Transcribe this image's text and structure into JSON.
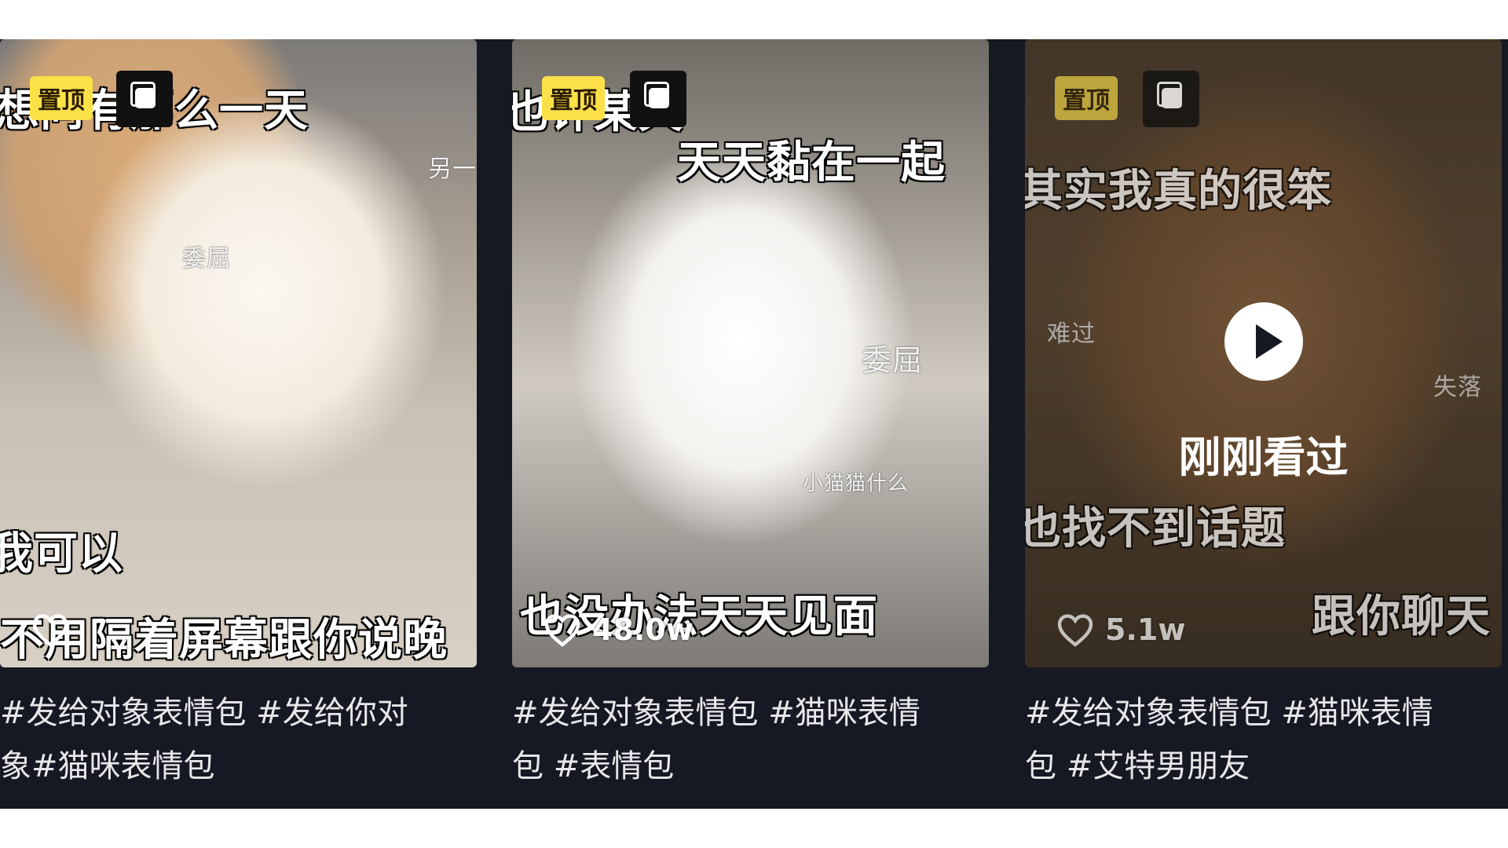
{
  "cards": [
    {
      "pin_label": "置顶",
      "captions": {
        "top": "想问有那么一天",
        "side": "另一只",
        "note": "委屈",
        "mid": "我可以",
        "bottom": "不用隔着屏幕跟你说晚"
      },
      "likes": "",
      "description": "#发给对象表情包 #发给你对\n象#猫咪表情包"
    },
    {
      "pin_label": "置顶",
      "captions": {
        "top": "也许某天",
        "line2": "天天黏在一起",
        "note": "委屈",
        "note2": "小猫猫什么",
        "bottom": "也没办法天天见面"
      },
      "likes": "48.0w",
      "description": "#发给对象表情包 #猫咪表情\n包 #表情包"
    },
    {
      "pin_label": "置顶",
      "captions": {
        "top": "其实我真的很笨",
        "note": "难过",
        "note2": "失落",
        "mid": "也找不到话题",
        "bottom": "跟你聊天"
      },
      "overlay_text": "刚刚看过",
      "likes": "5.1w",
      "description": "#发给对象表情包 #猫咪表情\n包 #艾特男朋友"
    }
  ],
  "colors": {
    "pin_bg": "#fce047",
    "strip_bg": "#161823",
    "desc_text": "#e8e8ea"
  },
  "icons": [
    "heart-icon",
    "multi-image-icon",
    "play-icon"
  ]
}
